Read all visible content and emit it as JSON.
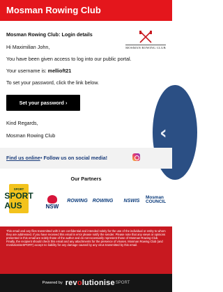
{
  "header": {
    "title": "Mosman Rowing Club"
  },
  "email": {
    "subject": "Mosman Rowing Club: Login details",
    "greeting": "Hi Maximilian John,",
    "access_text": "You have been given access to log into our public portal.",
    "username_label": "Your username is:",
    "username": "mellioft21",
    "password_instruction": "To set your password, click the link below.",
    "cta_label": "Set your password ›",
    "regards": "Kind Regards,",
    "signoff": "Mosman Rowing Club",
    "crest_text": "MOSMAN ROWING CLUB"
  },
  "social": {
    "find_us": "Find us online",
    "follow": "• Follow us on social media!"
  },
  "partners": {
    "title": "Our Partners",
    "logos": [
      "SPORT AUS",
      "NSW",
      "ROWING",
      "ROWING",
      "NSWIS",
      "Mosman COUNCIL"
    ]
  },
  "disclaimer": "This email and any files transmitted with it are confidential and intended solely for the use of the individual or entity to whom they are addressed. If you have received this email in error please notify the sender. Please note that any views or opinions presented in this email are solely those of the author and do not necessarily represent those of Mosman Rowing Club. Finally, the recipient should check this email and any attachments for the presence of viruses. Mosman Rowing Club (and revolutioniseSPORT) accept no liability for any damage caused by any virus transmitted by this email.",
  "footer": {
    "powered_by": "Powered by",
    "brand_main": "rev",
    "brand_accent": "o",
    "brand_rest": "lutionise",
    "brand_sport": "SPORT"
  },
  "colors": {
    "header_red": "#e4161c",
    "cta_black": "#000000",
    "footer_black": "#151515"
  }
}
